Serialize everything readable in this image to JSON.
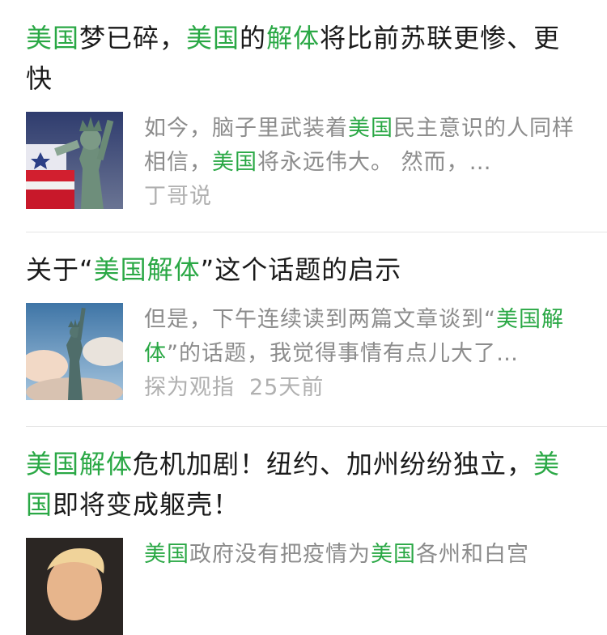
{
  "articles": [
    {
      "title_parts": [
        {
          "text": "美国",
          "hl": true
        },
        {
          "text": "梦已碎，",
          "hl": false
        },
        {
          "text": "美国",
          "hl": true
        },
        {
          "text": "的",
          "hl": false
        },
        {
          "text": "解体",
          "hl": true
        },
        {
          "text": "将比前苏联更惨、更快",
          "hl": false
        }
      ],
      "snippet_parts": [
        {
          "text": "如今，脑子里武装着",
          "hl": false
        },
        {
          "text": "美国",
          "hl": true
        },
        {
          "text": "民主意识的人同样相信，",
          "hl": false
        },
        {
          "text": "美国",
          "hl": true
        },
        {
          "text": "将永远伟大。 然而，…",
          "hl": false
        }
      ],
      "source": "丁哥说",
      "time": "",
      "thumbnail_icon": "statue-of-liberty-flag-image"
    },
    {
      "title_parts": [
        {
          "text": "关于“",
          "hl": false
        },
        {
          "text": "美国解体",
          "hl": true
        },
        {
          "text": "”这个话题的启示",
          "hl": false
        }
      ],
      "snippet_parts": [
        {
          "text": "但是，下午连续读到两篇文章谈到“",
          "hl": false
        },
        {
          "text": "美国解体",
          "hl": true
        },
        {
          "text": "”的话题，我觉得事情有点儿大了…",
          "hl": false
        }
      ],
      "source": "探为观指",
      "time": "25天前",
      "thumbnail_icon": "statue-of-liberty-sky-image"
    },
    {
      "title_parts": [
        {
          "text": "美国解体",
          "hl": true
        },
        {
          "text": "危机加剧！纽约、加州纷纷独立，",
          "hl": false
        },
        {
          "text": "美国",
          "hl": true
        },
        {
          "text": "即将变成躯壳！",
          "hl": false
        }
      ],
      "snippet_parts": [
        {
          "text": "美国",
          "hl": true
        },
        {
          "text": "政府没有把疫情为",
          "hl": false
        },
        {
          "text": "美国",
          "hl": true
        },
        {
          "text": "各州和白宫",
          "hl": false
        }
      ],
      "source": "",
      "time": "",
      "thumbnail_icon": "politician-portrait-image"
    }
  ]
}
